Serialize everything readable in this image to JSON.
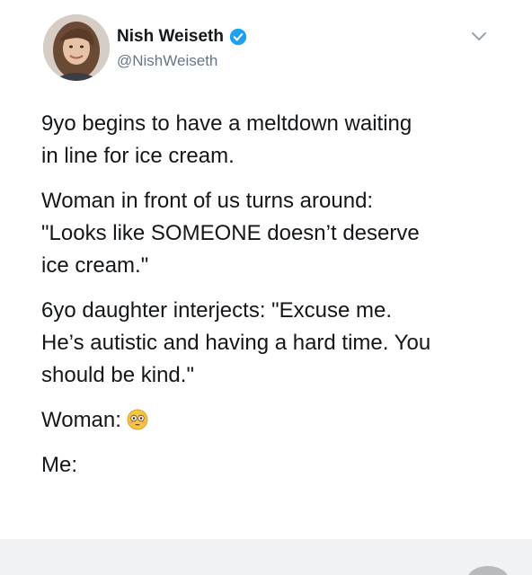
{
  "author": {
    "display_name": "Nish Weiseth",
    "handle": "@NishWeiseth",
    "verified": true,
    "avatar": "avatar-photo"
  },
  "header": {
    "menu_icon": "chevron-down-icon"
  },
  "tweet": {
    "paragraphs": [
      {
        "lines": [
          "9yo begins to have a meltdown waiting",
          "in line for ice cream."
        ]
      },
      {
        "lines": [
          "Woman in front of us turns around:",
          "\"Looks like SOMEONE doesn’t deserve",
          "ice cream.\""
        ]
      },
      {
        "lines": [
          "6yo daughter interjects: \"Excuse me.",
          "He’s autistic and having a hard time. You",
          "should be kind.\""
        ]
      },
      {
        "lines": [
          "Woman:"
        ],
        "emoji": "flushed-face-emoji"
      },
      {
        "lines": [
          "Me:"
        ]
      }
    ]
  },
  "colors": {
    "text": "#14171a",
    "secondary_text": "#657786",
    "verified_blue": "#1da1f2",
    "emoji_yellow": "#f6c343"
  }
}
